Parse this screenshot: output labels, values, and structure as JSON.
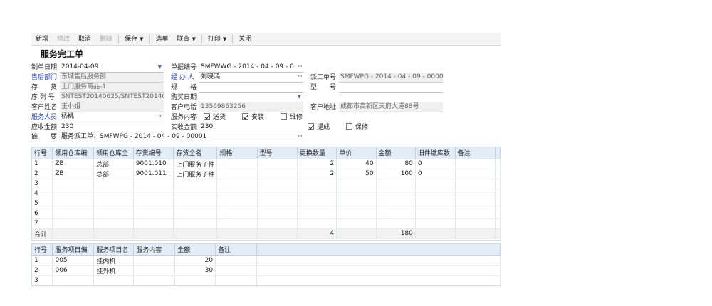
{
  "toolbar": {
    "new": "新增",
    "edit": "修改",
    "cancel": "取消",
    "delete": "删除",
    "save": "保存",
    "select": "选单",
    "link": "联查",
    "print": "打印",
    "close": "关闭"
  },
  "title": "服务完工单",
  "form": {
    "date_label": "制单日期",
    "date_value": "2014-04-09",
    "docno_label": "单据编号",
    "docno_value": "SMFWWG - 2014 - 04 - 09 - 0",
    "dept_label": "售后部门",
    "dept_value": "东城售后服务部",
    "handler_label": "经 办 人",
    "handler_value": "刘晓鸿",
    "dispatch_label": "派工单号",
    "dispatch_value": "SMFWPG - 2014 - 04 - 09 - 0000",
    "stock_label": "存　　货",
    "stock_value": "上门服务商品-1",
    "spec_label": "规　　格",
    "spec_value": "",
    "model_label": "型　　号",
    "model_value": "",
    "serial_label": "序 列 号",
    "serial_value": "SNTEST20140625/SNTEST20140",
    "buydate_label": "购买日期",
    "buydate_value": "",
    "cname_label": "客户姓名",
    "cname_value": "王小姐",
    "cphone_label": "客户电话",
    "cphone_value": "13569863256",
    "caddr_label": "客户地址",
    "caddr_value": "成都市高新区天府大道88号",
    "staff_label": "服务人员",
    "staff_value": "杨桃",
    "content_label": "服务内容",
    "opt_delivery": "送货",
    "opt_install": "安装",
    "opt_repair": "维修",
    "receivable_label": "应收金额",
    "receivable_value": "230",
    "actual_label": "实收金额",
    "actual_value": "230",
    "opt_commission": "提成",
    "opt_warranty": "保修",
    "summary_label": "摘　　要",
    "summary_value": "服务派工单：SMFWPG - 2014 - 04 - 09 - 00001"
  },
  "grid1": {
    "headers": [
      "行号",
      "领用仓库编",
      "领用仓库全",
      "存货编号",
      "存货全名",
      "规格",
      "型号",
      "更换数量",
      "单价",
      "金额",
      "旧件缴库数",
      "备注",
      ""
    ],
    "rows": [
      [
        "1",
        "ZB",
        "总部",
        "9001.010",
        "上门服务子件",
        "",
        "",
        "2",
        "40",
        "80",
        "0",
        "",
        ""
      ],
      [
        "2",
        "ZB",
        "总部",
        "9001.011",
        "上门服务子件",
        "",
        "",
        "2",
        "50",
        "100",
        "0",
        "",
        ""
      ],
      [
        "3",
        "",
        "",
        "",
        "",
        "",
        "",
        "",
        "",
        "",
        "",
        "",
        ""
      ],
      [
        "4",
        "",
        "",
        "",
        "",
        "",
        "",
        "",
        "",
        "",
        "",
        "",
        ""
      ],
      [
        "5",
        "",
        "",
        "",
        "",
        "",
        "",
        "",
        "",
        "",
        "",
        "",
        ""
      ],
      [
        "6",
        "",
        "",
        "",
        "",
        "",
        "",
        "",
        "",
        "",
        "",
        "",
        ""
      ],
      [
        "7",
        "",
        "",
        "",
        "",
        "",
        "",
        "",
        "",
        "",
        "",
        "",
        ""
      ]
    ],
    "total": [
      "合计",
      "",
      "",
      "",
      "",
      "",
      "",
      "4",
      "",
      "180",
      "",
      "",
      ""
    ]
  },
  "grid2": {
    "headers": [
      "行号",
      "服务项目编",
      "服务项目名",
      "服务内容",
      "金额",
      "备注",
      ""
    ],
    "rows": [
      [
        "1",
        "005",
        "挂内机",
        "",
        "20",
        "",
        ""
      ],
      [
        "2",
        "006",
        "挂外机",
        "",
        "30",
        "",
        ""
      ],
      [
        "3",
        "",
        "",
        "",
        "",
        "",
        ""
      ]
    ]
  }
}
